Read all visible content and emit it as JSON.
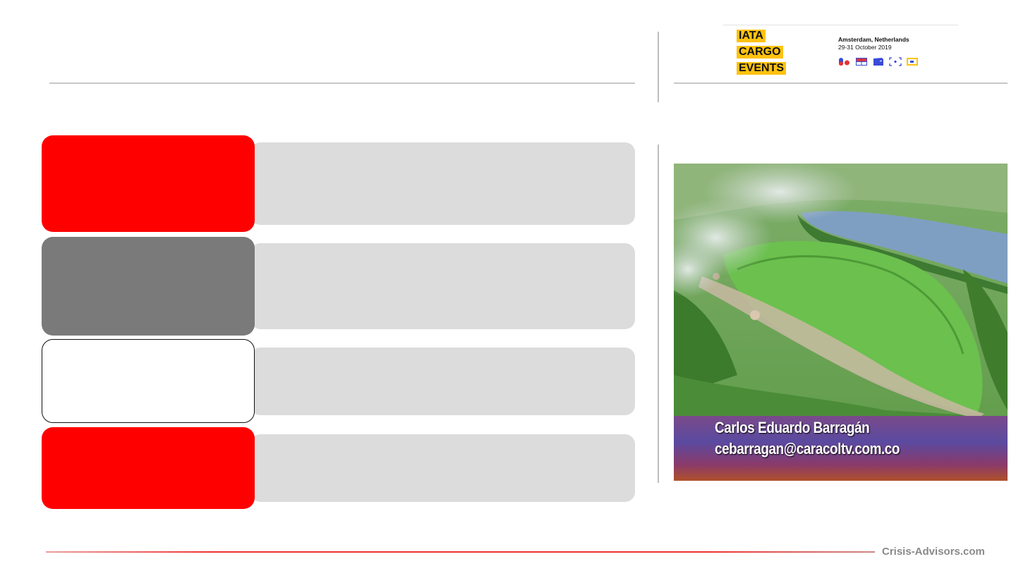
{
  "logo": {
    "word1": "IATA",
    "word2": "CARGO",
    "word3": "EVENTS",
    "brand_color": "#ffc20e"
  },
  "event": {
    "city": "Amsterdam, Netherlands",
    "dates": "29-31 October 2019",
    "icons": [
      "pill-icon",
      "grid-cross-icon",
      "box-icon",
      "focus-icon",
      "screen-icon"
    ]
  },
  "rows": [
    {
      "color": "#ff0000",
      "style": "red"
    },
    {
      "color": "#7a7a7a",
      "style": "grey"
    },
    {
      "color": "#ffffff",
      "style": "white-outlined"
    },
    {
      "color": "#ff0000",
      "style": "red"
    }
  ],
  "photo": {
    "name": "Carlos Eduardo Barragán",
    "email": "cebarragan@caracoltv.com.co"
  },
  "footer": {
    "brand": "Crisis-Advisors.com",
    "line_color": "#ee3333"
  }
}
